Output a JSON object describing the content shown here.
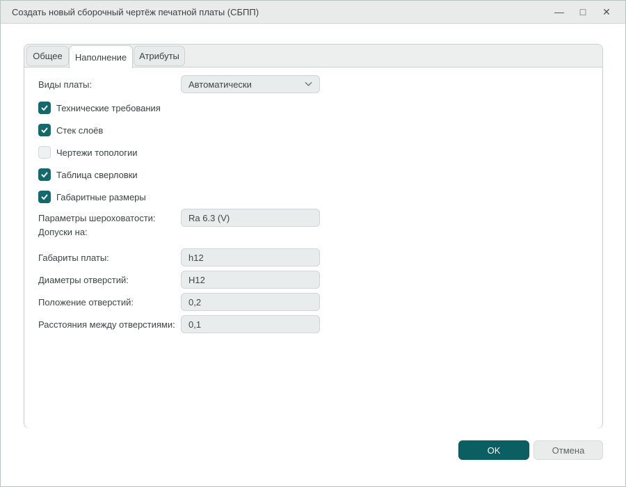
{
  "window": {
    "title": "Создать новый сборочный чертёж печатной платы (СБПП)",
    "controls": {
      "minimize_icon": "—",
      "maximize_icon": "□",
      "close_icon": "✕"
    }
  },
  "tabs": [
    {
      "label": "Общее",
      "active": false
    },
    {
      "label": "Наполнение",
      "active": true
    },
    {
      "label": "Атрибуты",
      "active": false
    }
  ],
  "form": {
    "board_views": {
      "label": "Виды платы:",
      "value": "Автоматически"
    },
    "checkboxes": [
      {
        "label": "Технические требования",
        "checked": true
      },
      {
        "label": "Стек слоёв",
        "checked": true
      },
      {
        "label": "Чертежи топологии",
        "checked": false
      },
      {
        "label": "Таблица сверловки",
        "checked": true
      },
      {
        "label": "Габаритные размеры",
        "checked": true
      }
    ],
    "roughness": {
      "label": "Параметры шероховатости:",
      "value": "Ra 6.3 (V)"
    },
    "tolerances_label": "Допуски на:",
    "fields": [
      {
        "label": "Габариты платы:",
        "value": "h12"
      },
      {
        "label": "Диаметры отверстий:",
        "value": "H12"
      },
      {
        "label": "Положение отверстий:",
        "value": "0,2"
      },
      {
        "label": "Расстояния между отверстиями:",
        "value": "0,1"
      }
    ]
  },
  "buttons": {
    "ok_label": "OK",
    "cancel_label": "Отмена"
  },
  "colors": {
    "accent_teal": "#0b5f63",
    "checkbox_teal": "#116a6d",
    "titlebar_bg": "#e9ebeb",
    "tabstrip_bg": "#edefef",
    "field_bg": "#e9ecec",
    "panel_border": "#c8d1d1"
  }
}
